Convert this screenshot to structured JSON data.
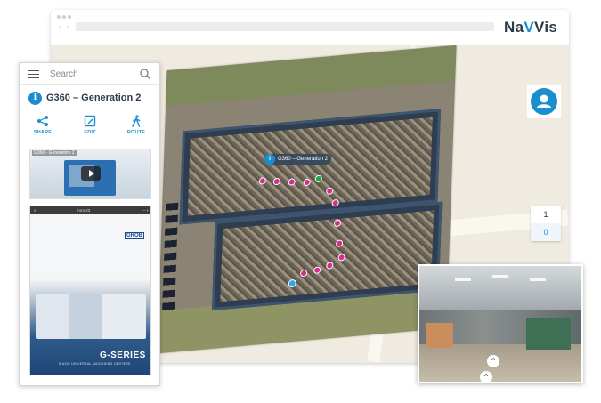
{
  "brand": {
    "name_part1": "Na",
    "name_accent": "V",
    "name_part2": "Vis"
  },
  "sidebar": {
    "search": {
      "placeholder": "Search"
    },
    "poi": {
      "info_glyph": "i",
      "title": "G360 – Generation 2"
    },
    "actions": [
      {
        "label": "SHARE",
        "icon": "share-icon"
      },
      {
        "label": "EDIT",
        "icon": "edit-icon"
      },
      {
        "label": "ROUTE",
        "icon": "walking-person-icon"
      }
    ],
    "video": {
      "title": "G360 - Generation 2"
    },
    "pdf": {
      "page_label": "from 23",
      "logo": "GROB",
      "brand": "G-SERIES",
      "subtitle": "5-AXIS UNIVERSAL MACHINING CENTERS"
    }
  },
  "map": {
    "pin_label": "G360 – Generation 2",
    "pin_info_glyph": "i",
    "floors": [
      "1",
      "0"
    ],
    "active_floor": "0"
  },
  "colors": {
    "accent": "#1a8fd0",
    "poi_pin": "#d62d8e",
    "building": "#2e3d4f"
  }
}
